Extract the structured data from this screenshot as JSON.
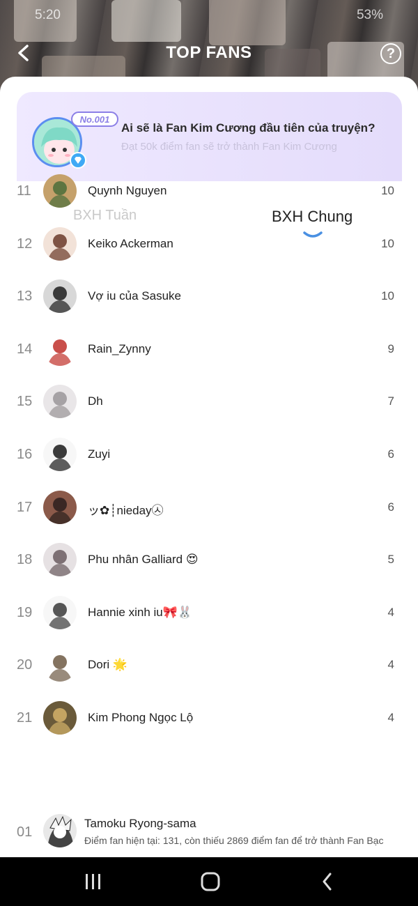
{
  "status": {
    "time": "5:20",
    "battery": "53%"
  },
  "header": {
    "title": "TOP FANS",
    "help_label": "?"
  },
  "banner": {
    "badge": "No.001",
    "title": "Ai sẽ là Fan Kim Cương đầu tiên của truyện?",
    "subtitle": "Đạt 50k điểm fan sẽ trở thành Fan Kim Cương"
  },
  "tabs": {
    "week": "BXH Tuần",
    "all": "BXH Chung"
  },
  "ranking": [
    {
      "rank": "11",
      "name": "Quynh Nguyen",
      "score": "10"
    },
    {
      "rank": "12",
      "name": "Keiko Ackerman",
      "score": "10"
    },
    {
      "rank": "13",
      "name": "Vợ iu của Sasuke",
      "score": "10"
    },
    {
      "rank": "14",
      "name": "Rain_Zynny",
      "score": "9"
    },
    {
      "rank": "15",
      "name": "Dh",
      "score": "7"
    },
    {
      "rank": "16",
      "name": "Zuyi",
      "score": "6"
    },
    {
      "rank": "17",
      "name": "ッ✿┊nieday㉦",
      "score": "6"
    },
    {
      "rank": "18",
      "name": "Phu nhân Galliard 😍",
      "score": "5"
    },
    {
      "rank": "19",
      "name": "Hannie xinh iu🎀🐰",
      "score": "4"
    },
    {
      "rank": "20",
      "name": "Dori 🌟",
      "score": "4"
    },
    {
      "rank": "21",
      "name": "Kim Phong Ngọc Lộ",
      "score": "4"
    }
  ],
  "me": {
    "rank": "01",
    "name": "Tamoku Ryong-sama",
    "desc": "Điểm fan hiện tại: 131, còn thiếu 2869 điểm fan để trở thành Fan Bạc"
  },
  "colors": {
    "accent": "#4a90e2",
    "banner_bg": "#e9e3fd",
    "badge": "#8b7fe6"
  }
}
